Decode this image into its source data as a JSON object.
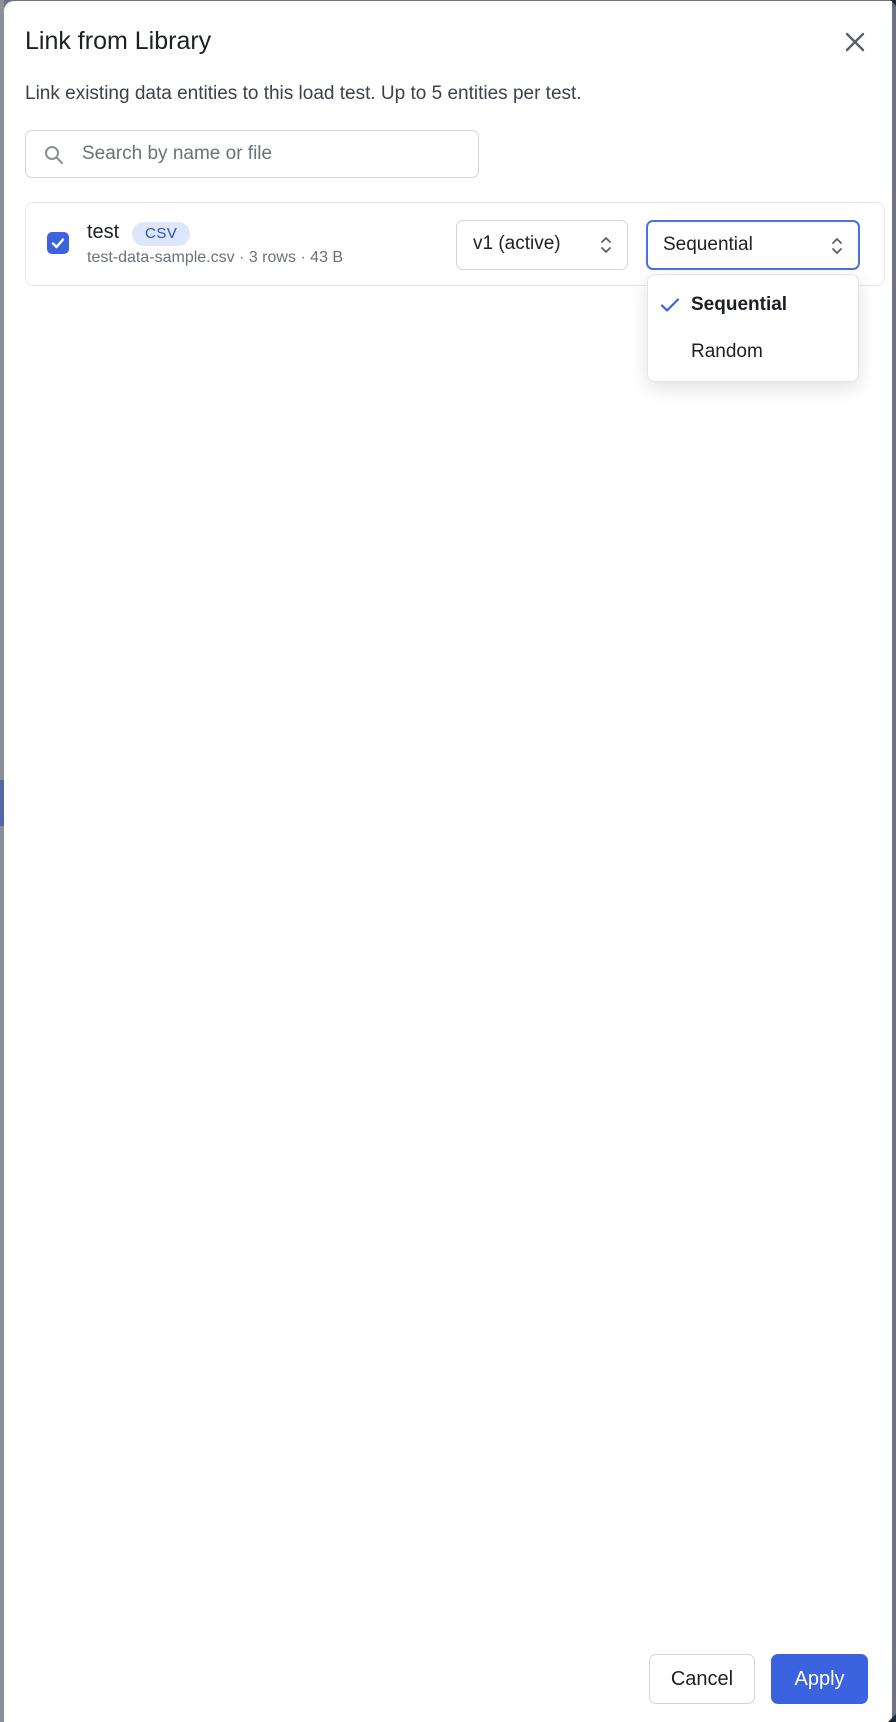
{
  "dialog": {
    "title": "Link from Library",
    "subtitle": "Link existing data entities to this load test. Up to 5 entities per test."
  },
  "search": {
    "placeholder": "Search by name or file",
    "value": ""
  },
  "entity": {
    "name": "test",
    "badge": "CSV",
    "meta": "test-data-sample.csv · 3 rows · 43 B",
    "checked": true,
    "version_value": "v1 (active)",
    "mode_value": "Sequential"
  },
  "mode_dropdown": {
    "options": [
      {
        "label": "Sequential",
        "selected": true
      },
      {
        "label": "Random",
        "selected": false
      }
    ]
  },
  "footer": {
    "cancel_label": "Cancel",
    "apply_label": "Apply"
  },
  "colors": {
    "accent": "#3b63e0",
    "badge_bg": "#dde6fb",
    "badge_text": "#2c4fb8",
    "focus_border": "#4a72e0"
  },
  "icons": {
    "close": "close-icon",
    "search": "search-icon",
    "checkbox": "checkmark-icon",
    "select": "chevron-up-down-icon",
    "selected_option": "check-icon"
  }
}
